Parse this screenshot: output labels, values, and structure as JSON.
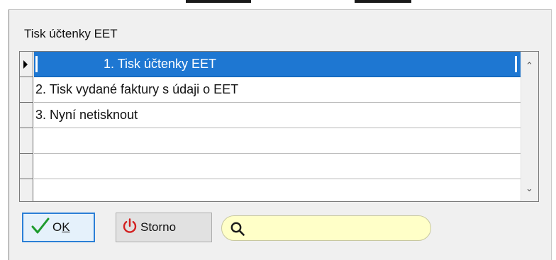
{
  "dialog": {
    "title": "Tisk účtenky EET"
  },
  "list": {
    "items": [
      {
        "label": "1. Tisk účtenky EET",
        "selected": true
      },
      {
        "label": "2. Tisk vydané faktury s údaji o EET",
        "selected": false
      },
      {
        "label": "3. Nyní netisknout",
        "selected": false
      },
      {
        "label": "",
        "selected": false
      },
      {
        "label": "",
        "selected": false
      },
      {
        "label": "",
        "selected": false
      }
    ],
    "selection_color": "#1e77d2"
  },
  "toolbar": {
    "ok_label_prefix": "O",
    "ok_label_underlined": "K",
    "ok_icon": "check-icon",
    "ok_icon_color": "#1e9b2e",
    "storno_label": "Storno",
    "storno_icon": "power-icon",
    "storno_icon_color": "#d32020",
    "search_icon": "search-icon",
    "search_value": "",
    "search_placeholder": ""
  }
}
